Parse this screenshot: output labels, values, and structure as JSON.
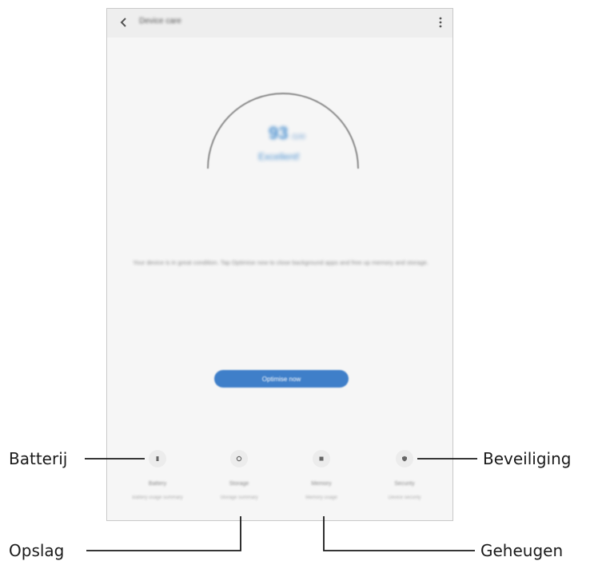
{
  "screen": {
    "app_bar": {
      "title": "Device care"
    },
    "score": {
      "value": "93",
      "unit": "/100",
      "status": "Excellent!"
    },
    "description": "Your device is in great condition. Tap Optimise now to close background apps and free up memory and storage.",
    "optimise_button_label": "Optimise now",
    "categories": [
      {
        "label": "Battery",
        "sub": "Battery usage summary"
      },
      {
        "label": "Storage",
        "sub": "Storage summary"
      },
      {
        "label": "Memory",
        "sub": "Memory usage"
      },
      {
        "label": "Security",
        "sub": "Device security"
      }
    ]
  },
  "callouts": {
    "battery": "Batterij",
    "storage": "Opslag",
    "memory": "Geheugen",
    "security": "Beveiliging"
  },
  "colors": {
    "accent": "#4a90d0",
    "button": "#3f7fc9",
    "leader_line": "#1a1a1a"
  }
}
